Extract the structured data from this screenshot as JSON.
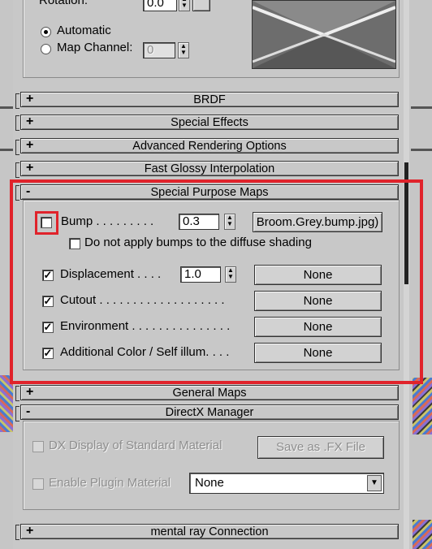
{
  "top_section": {
    "rotation_label": "Rotation:",
    "rotation_value": "0.0",
    "mapping_options": [
      {
        "label": "Automatic",
        "selected": true
      },
      {
        "label": "Map Channel:",
        "selected": false
      }
    ],
    "map_channel_value": "0"
  },
  "rollouts_collapsed": [
    {
      "sign": "+",
      "title": "BRDF"
    },
    {
      "sign": "+",
      "title": "Special Effects"
    },
    {
      "sign": "+",
      "title": "Advanced Rendering Options"
    },
    {
      "sign": "+",
      "title": "Fast Glossy Interpolation"
    }
  ],
  "special_purpose_maps": {
    "sign": "-",
    "title": "Special Purpose Maps",
    "bump": {
      "label": "Bump . . . . . . . . .",
      "checked": false,
      "value": "0.3",
      "map": "Broom.Grey.bump.jpg)"
    },
    "no_diffuse_label": "Do not apply bumps to the diffuse shading",
    "rows": [
      {
        "label": "Displacement . . . .",
        "checked": true,
        "value": "1.0",
        "map": "None"
      },
      {
        "label": "Cutout . . . . . . . . . . . . . . . . . . .",
        "checked": true,
        "map": "None"
      },
      {
        "label": "Environment . . . . . . . . . . . . . . .",
        "checked": true,
        "map": "None"
      },
      {
        "label": "Additional Color / Self illum. . . .",
        "checked": true,
        "map": "None"
      }
    ]
  },
  "general_maps": {
    "sign": "+",
    "title": "General Maps"
  },
  "directx_manager": {
    "sign": "-",
    "title": "DirectX Manager",
    "dx_display_label": "DX Display of Standard Material",
    "save_fx_label": "Save as .FX File",
    "enable_plugin_label": "Enable Plugin Material",
    "plugin_select_value": "None"
  },
  "mental_ray": {
    "sign": "+",
    "title": "mental ray Connection"
  },
  "colors": {
    "highlight_red": "#e0232b",
    "panel_gray": "#c8c8c8"
  }
}
